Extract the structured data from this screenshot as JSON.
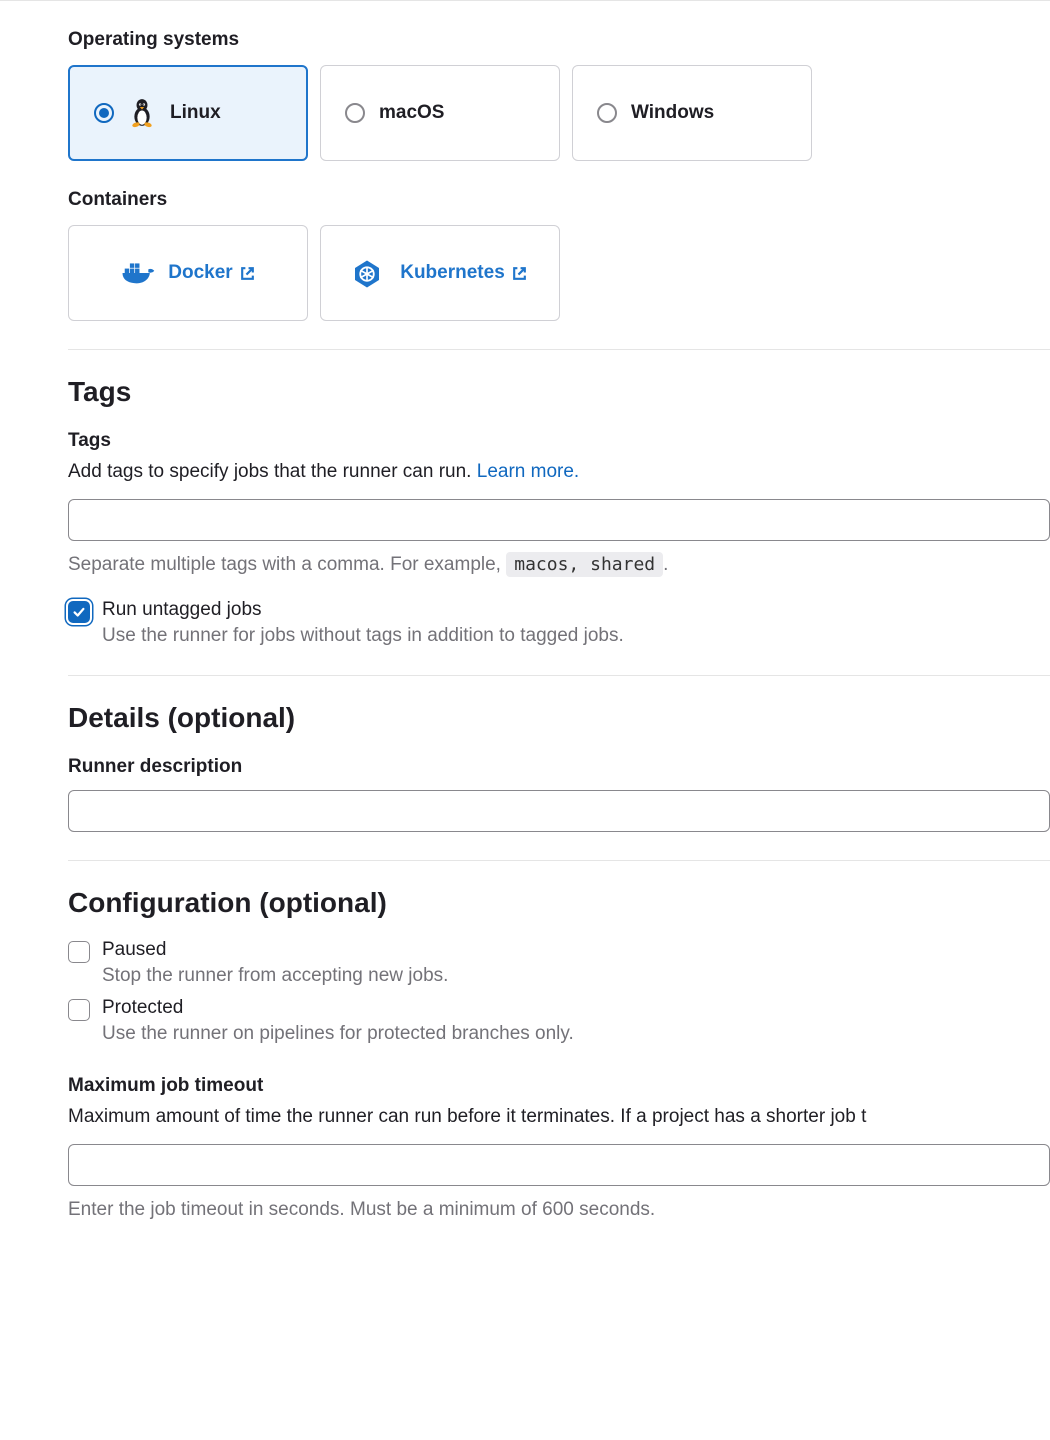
{
  "os_section": {
    "title": "Operating systems",
    "options": [
      {
        "label": "Linux",
        "selected": true
      },
      {
        "label": "macOS",
        "selected": false
      },
      {
        "label": "Windows",
        "selected": false
      }
    ]
  },
  "containers_section": {
    "title": "Containers",
    "options": [
      {
        "label": "Docker"
      },
      {
        "label": "Kubernetes"
      }
    ]
  },
  "tags_section": {
    "heading": "Tags",
    "label": "Tags",
    "help": "Add tags to specify jobs that the runner can run. ",
    "learn_more": "Learn more.",
    "hint_prefix": "Separate multiple tags with a comma. For example, ",
    "hint_code": "macos, shared",
    "hint_suffix": ".",
    "run_untagged": {
      "checked": true,
      "label": "Run untagged jobs",
      "hint": "Use the runner for jobs without tags in addition to tagged jobs."
    }
  },
  "details_section": {
    "heading": "Details (optional)",
    "desc_label": "Runner description"
  },
  "config_section": {
    "heading": "Configuration (optional)",
    "paused": {
      "checked": false,
      "label": "Paused",
      "hint": "Stop the runner from accepting new jobs."
    },
    "protected": {
      "checked": false,
      "label": "Protected",
      "hint": "Use the runner on pipelines for protected branches only."
    },
    "timeout": {
      "label": "Maximum job timeout",
      "help": "Maximum amount of time the runner can run before it terminates. If a project has a shorter job t",
      "hint": "Enter the job timeout in seconds. Must be a minimum of 600 seconds."
    }
  }
}
